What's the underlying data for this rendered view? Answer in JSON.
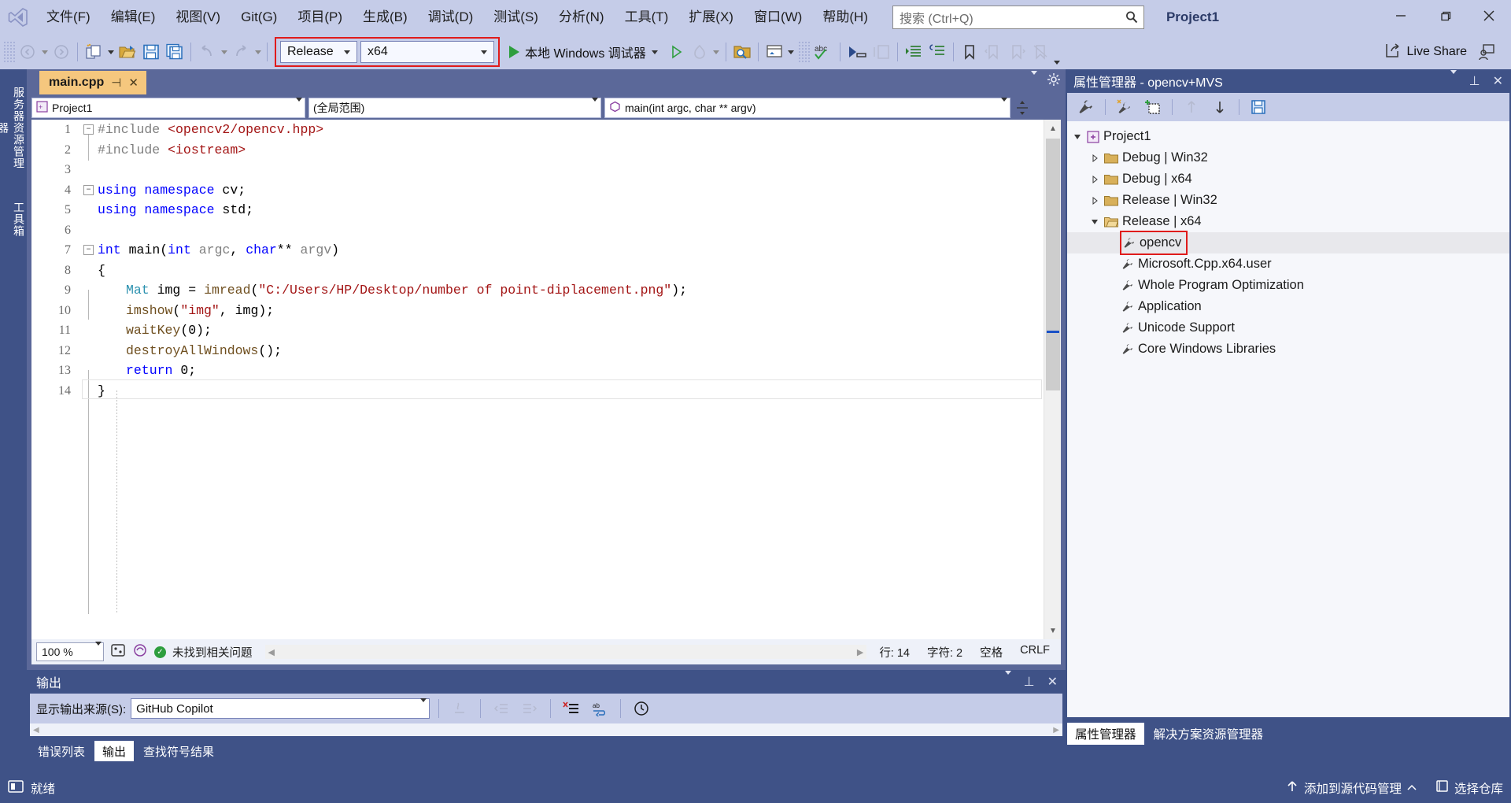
{
  "app": {
    "project_title": "Project1",
    "accent_red": "#e01b1b",
    "chrome_blue": "#3f5287",
    "toolbar_bg": "#c5cce8"
  },
  "menubar": {
    "logo": "visual-studio-logo",
    "items": [
      "文件(F)",
      "编辑(E)",
      "视图(V)",
      "Git(G)",
      "项目(P)",
      "生成(B)",
      "调试(D)",
      "测试(S)",
      "分析(N)",
      "工具(T)",
      "扩展(X)",
      "窗口(W)",
      "帮助(H)"
    ],
    "search_placeholder": "搜索 (Ctrl+Q)",
    "window_controls": {
      "minimize": "—",
      "maximize": "❐",
      "close": "✕"
    }
  },
  "toolbar": {
    "nav_back": "navigate-back",
    "nav_forward": "navigate-forward",
    "new_item": "new-item",
    "open_file": "open-file",
    "save": "save",
    "save_all": "save-all",
    "undo": "undo",
    "redo": "redo",
    "configuration": "Release",
    "platform": "x64",
    "run_label": "本地 Windows 调试器",
    "live_share_label": "Live Share"
  },
  "left_rail": {
    "tabs": [
      "服务器资源管理器",
      "工具箱"
    ]
  },
  "editor": {
    "tab_name": "main.cpp",
    "nav": {
      "project": "Project1",
      "scope": "(全局范围)",
      "member": "main(int argc, char ** argv)"
    },
    "lines": [
      {
        "no": "1",
        "fold": "minus",
        "indent": 0,
        "tokens": [
          {
            "t": "#include ",
            "c": "pp"
          },
          {
            "t": "<opencv2/opencv.hpp>",
            "c": "s"
          }
        ]
      },
      {
        "no": "2",
        "fold": "",
        "indent": 0,
        "tokens": [
          {
            "t": "#include ",
            "c": "pp"
          },
          {
            "t": "<iostream>",
            "c": "s"
          }
        ]
      },
      {
        "no": "3",
        "fold": "",
        "indent": 0,
        "tokens": []
      },
      {
        "no": "4",
        "fold": "minus",
        "indent": 0,
        "tokens": [
          {
            "t": "using namespace",
            "c": "k"
          },
          {
            "t": " cv;",
            "c": "n"
          }
        ]
      },
      {
        "no": "5",
        "fold": "",
        "indent": 0,
        "tokens": [
          {
            "t": "using namespace",
            "c": "k"
          },
          {
            "t": " std;",
            "c": "n"
          }
        ]
      },
      {
        "no": "6",
        "fold": "",
        "indent": 0,
        "tokens": []
      },
      {
        "no": "7",
        "fold": "minus",
        "indent": 0,
        "tokens": [
          {
            "t": "int",
            "c": "k"
          },
          {
            "t": " main(",
            "c": "n"
          },
          {
            "t": "int",
            "c": "k"
          },
          {
            "t": " ",
            "c": "n"
          },
          {
            "t": "argc",
            "c": "g"
          },
          {
            "t": ", ",
            "c": "n"
          },
          {
            "t": "char",
            "c": "k"
          },
          {
            "t": "** ",
            "c": "n"
          },
          {
            "t": "argv",
            "c": "g"
          },
          {
            "t": ")",
            "c": "n"
          }
        ]
      },
      {
        "no": "8",
        "fold": "",
        "indent": 0,
        "tokens": [
          {
            "t": "{",
            "c": "n"
          }
        ]
      },
      {
        "no": "9",
        "fold": "",
        "indent": 1,
        "tokens": [
          {
            "t": "Mat",
            "c": "t"
          },
          {
            "t": " ",
            "c": "n"
          },
          {
            "t": "img",
            "c": "n"
          },
          {
            "t": " = ",
            "c": "n"
          },
          {
            "t": "imread",
            "c": "f"
          },
          {
            "t": "(",
            "c": "n"
          },
          {
            "t": "\"C:/Users/HP/Desktop/number of point-diplacement.png\"",
            "c": "s"
          },
          {
            "t": ");",
            "c": "n"
          }
        ]
      },
      {
        "no": "10",
        "fold": "",
        "indent": 1,
        "tokens": [
          {
            "t": "imshow",
            "c": "f"
          },
          {
            "t": "(",
            "c": "n"
          },
          {
            "t": "\"img\"",
            "c": "s"
          },
          {
            "t": ", ",
            "c": "n"
          },
          {
            "t": "img",
            "c": "n"
          },
          {
            "t": ");",
            "c": "n"
          }
        ]
      },
      {
        "no": "11",
        "fold": "",
        "indent": 1,
        "tokens": [
          {
            "t": "waitKey",
            "c": "f"
          },
          {
            "t": "(",
            "c": "n"
          },
          {
            "t": "0",
            "c": "n"
          },
          {
            "t": ");",
            "c": "n"
          }
        ]
      },
      {
        "no": "12",
        "fold": "",
        "indent": 1,
        "tokens": [
          {
            "t": "destroyAllWindows",
            "c": "f"
          },
          {
            "t": "();",
            "c": "n"
          }
        ]
      },
      {
        "no": "13",
        "fold": "",
        "indent": 1,
        "tokens": [
          {
            "t": "return",
            "c": "k"
          },
          {
            "t": " 0;",
            "c": "n"
          }
        ]
      },
      {
        "no": "14",
        "fold": "",
        "indent": 0,
        "tokens": [
          {
            "t": "}",
            "c": "n"
          }
        ]
      }
    ],
    "status": {
      "zoom": "100 %",
      "issue_text": "未找到相关问题",
      "line": "行: 14",
      "col": "字符: 2",
      "spaces": "空格",
      "eol": "CRLF"
    }
  },
  "output": {
    "title": "输出",
    "source_label": "显示输出来源(S):",
    "source_value": "GitHub Copilot",
    "buttons": [
      "find-message-source",
      "go-to-previous",
      "go-to-next",
      "clear-all",
      "toggle-word-wrap",
      "show-timestamps"
    ],
    "tabs": [
      {
        "label": "错误列表",
        "active": false
      },
      {
        "label": "输出",
        "active": true
      },
      {
        "label": "查找符号结果",
        "active": false
      }
    ]
  },
  "property_manager": {
    "title": "属性管理器 - opencv+MVS",
    "toolbar_buttons": [
      "properties",
      "add-property-sheet",
      "add-new-project-property-sheet",
      "move-up",
      "move-down",
      "save"
    ],
    "tree": [
      {
        "label": "Project1",
        "level": 0,
        "twist": "expanded",
        "icon": "project-icon",
        "selected": false,
        "highlight": false
      },
      {
        "label": "Debug | Win32",
        "level": 1,
        "twist": "collapsed",
        "icon": "folder-icon",
        "selected": false,
        "highlight": false
      },
      {
        "label": "Debug | x64",
        "level": 1,
        "twist": "collapsed",
        "icon": "folder-icon",
        "selected": false,
        "highlight": false
      },
      {
        "label": "Release | Win32",
        "level": 1,
        "twist": "collapsed",
        "icon": "folder-icon",
        "selected": false,
        "highlight": false
      },
      {
        "label": "Release | x64",
        "level": 1,
        "twist": "expanded",
        "icon": "folder-open-icon",
        "selected": false,
        "highlight": false
      },
      {
        "label": "opencv",
        "level": 2,
        "twist": "",
        "icon": "wrench-icon",
        "selected": true,
        "highlight": true
      },
      {
        "label": "Microsoft.Cpp.x64.user",
        "level": 2,
        "twist": "",
        "icon": "wrench-icon",
        "selected": false,
        "highlight": false
      },
      {
        "label": "Whole Program Optimization",
        "level": 2,
        "twist": "",
        "icon": "wrench-icon",
        "selected": false,
        "highlight": false
      },
      {
        "label": "Application",
        "level": 2,
        "twist": "",
        "icon": "wrench-icon",
        "selected": false,
        "highlight": false
      },
      {
        "label": "Unicode Support",
        "level": 2,
        "twist": "",
        "icon": "wrench-icon",
        "selected": false,
        "highlight": false
      },
      {
        "label": "Core Windows Libraries",
        "level": 2,
        "twist": "",
        "icon": "wrench-icon",
        "selected": false,
        "highlight": false
      }
    ],
    "tabs": [
      {
        "label": "属性管理器",
        "active": true
      },
      {
        "label": "解决方案资源管理器",
        "active": false
      }
    ]
  },
  "statusbar": {
    "ready": "就绪",
    "add_to_source_control": "添加到源代码管理",
    "select_repository": "选择仓库"
  }
}
